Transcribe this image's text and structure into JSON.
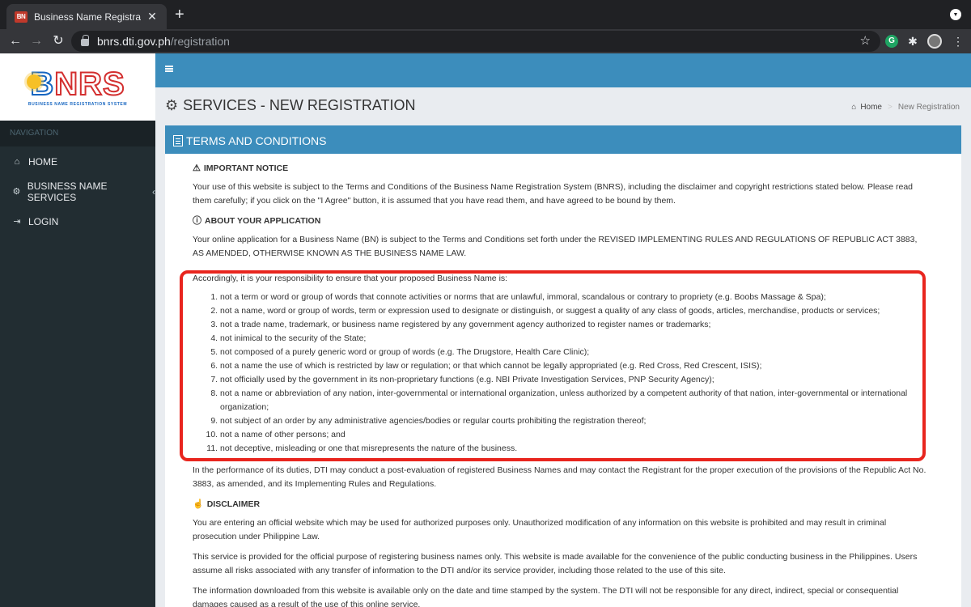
{
  "browser": {
    "tab_title": "Business Name Registration - B",
    "tab_favicon": "BN",
    "url_host": "bnrs.dti.gov.ph",
    "url_path": "/registration",
    "ext_g": "G"
  },
  "logo": {
    "text_b": "B",
    "text_rest": "NRS",
    "subtitle": "BUSINESS NAME REGISTRATION SYSTEM"
  },
  "sidebar": {
    "header": "NAVIGATION",
    "items": [
      {
        "label": "HOME",
        "icon": "home-icon"
      },
      {
        "label": "BUSINESS NAME SERVICES",
        "icon": "cogs-icon",
        "chevron": "‹"
      },
      {
        "label": "LOGIN",
        "icon": "sign-in-icon"
      }
    ]
  },
  "page": {
    "title": "SERVICES - NEW REGISTRATION",
    "breadcrumb": {
      "home": "Home",
      "current": "New Registration"
    }
  },
  "box": {
    "title": "TERMS AND CONDITIONS"
  },
  "terms": {
    "notice_head": "IMPORTANT NOTICE",
    "notice_text": "Your use of this website is subject to the Terms and Conditions of the Business Name Registration System (BNRS), including the disclaimer and copyright restrictions stated below. Please read them carefully; if you click on the \"I Agree\" button, it is assumed that you have read them, and have agreed to be bound by them.",
    "about_head": "ABOUT YOUR APPLICATION",
    "about_text": "Your online application for a Business Name (BN) is subject to the Terms and Conditions set forth under the REVISED IMPLEMENTING RULES AND REGULATIONS OF REPUBLIC ACT 3883, AS AMENDED, OTHERWISE KNOWN AS THE BUSINESS NAME LAW.",
    "responsibility_text": "Accordingly, it is your responsibility to ensure that your proposed Business Name is:",
    "requirements": [
      "not a term or word or group of words that connote activities or norms that are unlawful, immoral, scandalous or contrary to propriety (e.g. Boobs Massage & Spa);",
      "not a name, word or group of words, term or expression used to designate or distinguish, or suggest a quality of any class of goods, articles, merchandise, products or services;",
      "not a trade name, trademark, or business name registered by any government agency authorized to register names or trademarks;",
      "not inimical to the security of the State;",
      "not composed of a purely generic word or group of words (e.g. The Drugstore, Health Care Clinic);",
      "not a name the use of which is restricted by law or regulation; or that which cannot be legally appropriated (e.g. Red Cross, Red Crescent, ISIS);",
      "not officially used by the government in its non-proprietary functions (e.g. NBI Private Investigation Services, PNP Security Agency);",
      "not a name or abbreviation of any nation, inter-governmental or international organization, unless authorized by a competent authority of that nation, inter-governmental or international organization;",
      "not subject of an order by any administrative agencies/bodies or regular courts prohibiting the registration thereof;",
      "not a name of other persons; and",
      "not deceptive, misleading or one that misrepresents the nature of the business."
    ],
    "post_eval_text": "In the performance of its duties, DTI may conduct a post-evaluation of registered Business Names and may contact the Registrant for the proper execution of the provisions of the Republic Act No. 3883, as amended, and its Implementing Rules and Regulations.",
    "disclaimer_head": "DISCLAIMER",
    "disclaimer_text_1": "You are entering an official website which may be used for authorized purposes only. Unauthorized modification of any information on this website is prohibited and may result in criminal prosecution under Philippine Law.",
    "disclaimer_text_2": "This service is provided for the official purpose of registering business names only. This website is made available for the convenience of the public conducting business in the Philippines. Users assume all risks associated with any transfer of information to the DTI and/or its service provider, including those related to the use of this site.",
    "disclaimer_text_3": "The information downloaded from this website is available only on the date and time stamped by the system. The DTI will not be responsible for any direct, indirect, special or consequential damages caused as a result of the use of this online service."
  },
  "colors": {
    "primary": "#3c8dbc",
    "sidebar": "#222d32",
    "highlight": "#e8251e"
  }
}
